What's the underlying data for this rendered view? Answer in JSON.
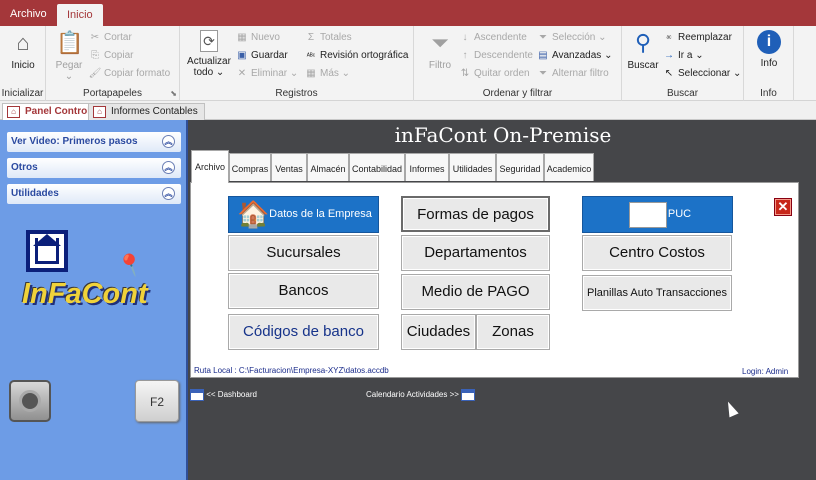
{
  "file_tabs": [
    {
      "label": "Archivo"
    },
    {
      "label": "Inicio"
    }
  ],
  "ribbon": {
    "groups": {
      "inicializar": "Inicializar",
      "portapapeles": "Portapapeles",
      "registros": "Registros",
      "ordenar": "Ordenar y filtrar",
      "buscar": "Buscar",
      "info": "Info"
    },
    "inicio": "Inicio",
    "pegar": "Pegar",
    "cortar": "Cortar",
    "copiar": "Copiar",
    "copiar_formato": "Copiar formato",
    "actualizar_1": "Actualizar",
    "actualizar_2": "todo",
    "nuevo": "Nuevo",
    "guardar": "Guardar",
    "eliminar": "Eliminar",
    "totales": "Totales",
    "revision": "Revisión ortográfica",
    "mas": "Más",
    "filtro": "Filtro",
    "ascendente": "Ascendente",
    "descendente": "Descendente",
    "quitar_orden": "Quitar orden",
    "seleccion": "Selección",
    "avanzadas": "Avanzadas",
    "alternar_filtro": "Alternar filtro",
    "buscar_btn": "Buscar",
    "reemplazar": "Reemplazar",
    "ir_a": "Ir a",
    "seleccionar": "Seleccionar",
    "info_btn": "Info"
  },
  "doc_tabs": [
    {
      "label": "Panel Control"
    },
    {
      "label": "Informes Contables"
    }
  ],
  "sidebar": {
    "items": [
      {
        "label": "Ver Video: Primeros pasos"
      },
      {
        "label": "Otros"
      },
      {
        "label": "Utilidades"
      }
    ],
    "logo_text": "InFaCont",
    "f2_label": "F2"
  },
  "main": {
    "title": "inFaCont On-Premise",
    "tabs": [
      "Archivo",
      "Compras",
      "Ventas",
      "Almacén",
      "Contabilidad",
      "Informes",
      "Utilidades",
      "Seguridad",
      "Academico"
    ],
    "buttons": {
      "datos_empresa": "Datos de la Empresa",
      "formas_pagos": "Formas de pagos",
      "puc": "PUC",
      "sucursales": "Sucursales",
      "departamentos": "Departamentos",
      "centro_costos": "Centro Costos",
      "bancos": "Bancos",
      "medio_pago": "Medio de PAGO",
      "planillas": "Planillas Auto Transacciones",
      "codigos_banco": "Códigos de banco",
      "ciudades": "Ciudades",
      "zonas": "Zonas"
    },
    "ruta_local": "Ruta Local : C:\\Facturacion\\Empresa-XYZ\\datos.accdb",
    "login": "Login: Admin",
    "dashboard_link": "<< Dashboard",
    "calendario_link": "Calendario Actividades >>"
  }
}
